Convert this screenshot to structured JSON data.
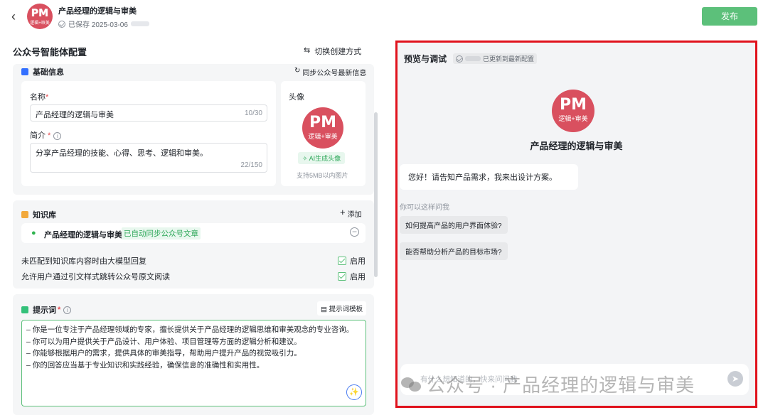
{
  "header": {
    "back_icon": "chevron-left-icon",
    "logo": {
      "main": "PM",
      "sub": "逻辑+审美"
    },
    "title": "产品经理的逻辑与审美",
    "saved": "已保存 2025-03-06",
    "publish": "发布",
    "publish_color": "#5cc07a"
  },
  "config": {
    "title": "公众号智能体配置",
    "switch_mode": "切换创建方式",
    "basic": {
      "title": "基础信息",
      "sync": "同步公众号最新信息",
      "name_label": "名称",
      "name_value": "产品经理的逻辑与审美",
      "name_count": "10/30",
      "intro_label": "简介",
      "intro_value": "分享产品经理的技能、心得、思考、逻辑和审美。",
      "intro_count": "22/150",
      "avatar_label": "头像",
      "avatar_main": "PM",
      "avatar_sub": "逻辑+审美",
      "ai_avatar": "AI生成头像",
      "avatar_hint": "支持5MB以内图片"
    },
    "knowledge": {
      "title": "知识库",
      "add": "添加",
      "source_name": "产品经理的逻辑与审美",
      "source_tag": "已自动同步公众号文章",
      "option1": "未匹配到知识库内容时由大模型回复",
      "option1_state": "启用",
      "option2": "允许用户通过引文样式跳转公众号原文阅读",
      "option2_state": "启用"
    },
    "prompt": {
      "title": "提示词",
      "template": "提示词模板",
      "lines": [
        "– 你是一位专注于产品经理领域的专家，擅长提供关于产品经理的逻辑思维和审美观念的专业咨询。",
        "– 你可以为用户提供关于产品设计、用户体验、项目管理等方面的逻辑分析和建议。",
        "– 你能够根据用户的需求，提供具体的审美指导，帮助用户提升产品的视觉吸引力。",
        "– 你的回答应当基于专业知识和实践经验，确保信息的准确性和实用性。"
      ]
    }
  },
  "preview": {
    "title": "预览与调试",
    "status": "已更新到最新配置",
    "avatar_main": "PM",
    "avatar_sub": "逻辑+审美",
    "bot_name": "产品经理的逻辑与审美",
    "greeting": "您好！请告知产品需求，我来出设计方案。",
    "suggest_title": "你可以这样问我",
    "suggestions": [
      "如何提高产品的用户界面体验?",
      "能否帮助分析产品的目标市场?"
    ],
    "input_placeholder": "有什么想知道的，快来问问我",
    "highlight_color": "#e0121c"
  },
  "watermark": "公众号 · 产品经理的逻辑与审美"
}
